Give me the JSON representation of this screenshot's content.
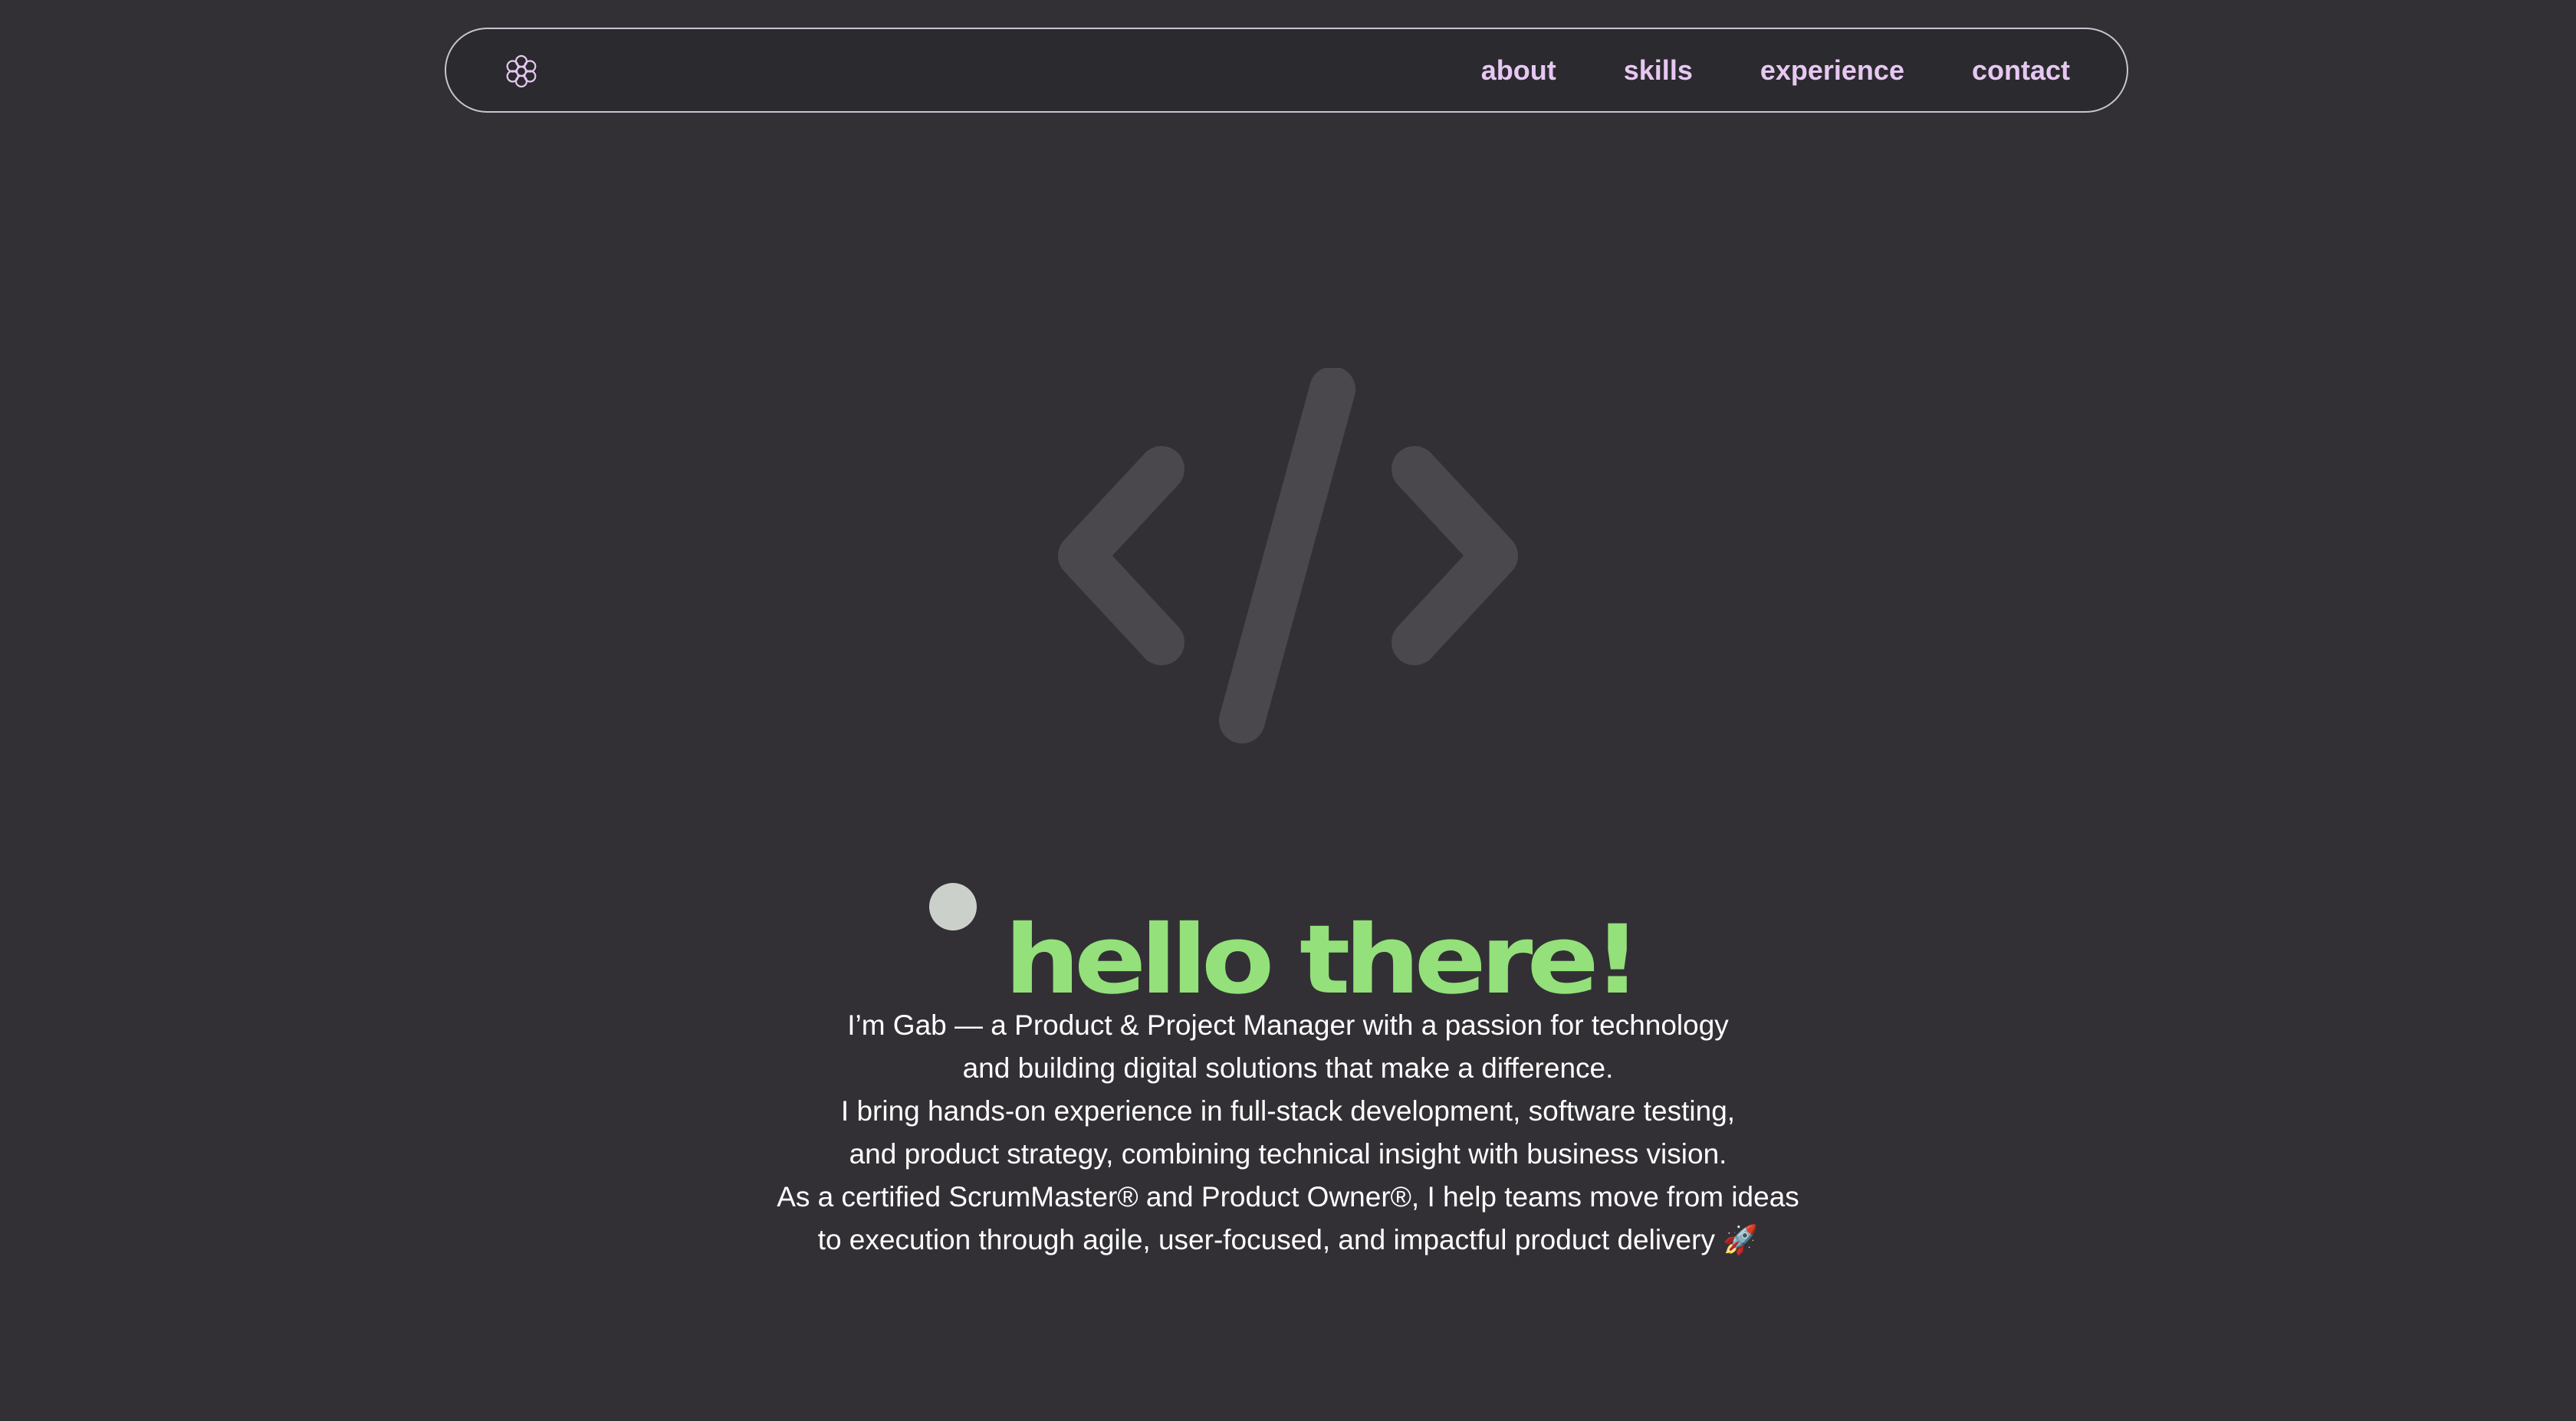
{
  "colors": {
    "background": "#323035",
    "nav_border": "#c9c4d1",
    "nav_link": "#e6c8f2",
    "hero_title": "#94e07a",
    "dot": "#ccd0cb",
    "code_icon": "#4a484d",
    "text": "#ffffff"
  },
  "nav": {
    "logo_icon": "snowflake-flower-icon",
    "links": [
      {
        "label": "about"
      },
      {
        "label": "skills"
      },
      {
        "label": "experience"
      },
      {
        "label": "contact"
      }
    ]
  },
  "hero": {
    "icon": "code-brackets-icon",
    "title": "hello there!",
    "intro_lines": [
      "I’m Gab — a Product & Project Manager with a passion for technology",
      "and building digital solutions that make a difference.",
      "I bring hands-on experience in full-stack development, software testing,",
      "and product strategy, combining technical insight with business vision.",
      "As a certified ScrumMaster® and Product Owner®, I help teams move from ideas",
      "to execution through agile, user-focused, and impactful product delivery 🚀"
    ]
  }
}
